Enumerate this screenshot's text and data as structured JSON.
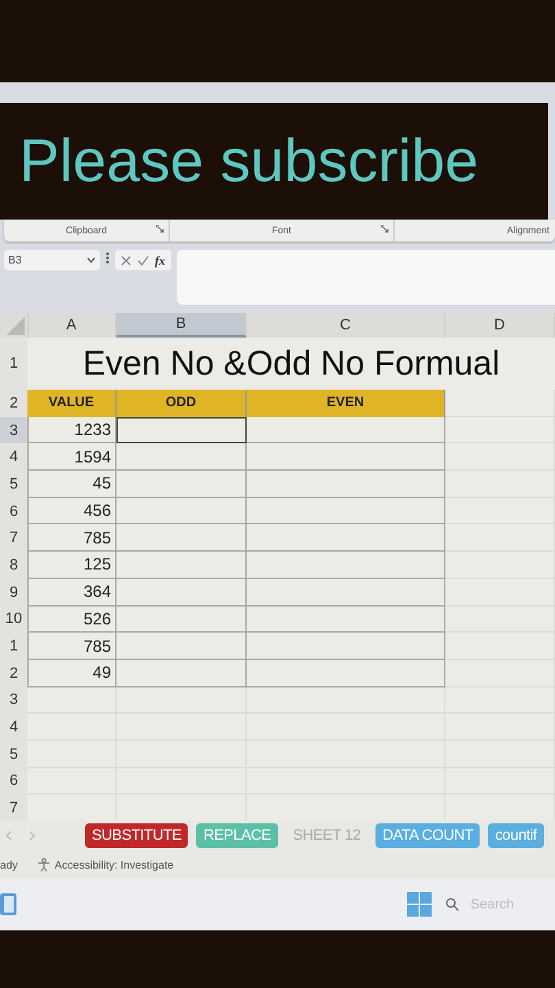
{
  "overlay": {
    "text": "Please subscribe"
  },
  "ribbon": {
    "groups": [
      {
        "label": "Clipboard",
        "launcher": true
      },
      {
        "label": "Font",
        "launcher": true
      },
      {
        "label": "Alignment",
        "launcher": false
      }
    ]
  },
  "formula_bar": {
    "name_box": "B3",
    "function_label": "fx"
  },
  "columns": [
    {
      "label": "A",
      "selected": false
    },
    {
      "label": "B",
      "selected": true
    },
    {
      "label": "C",
      "selected": false
    },
    {
      "label": "D",
      "selected": false
    }
  ],
  "title_row": {
    "header": "1",
    "text": "Even No &Odd No Formual"
  },
  "header_row": {
    "header": "2",
    "labels": [
      "VALUE",
      "ODD",
      "EVEN"
    ]
  },
  "rows": [
    {
      "header": "3",
      "selected": true,
      "cells": [
        {
          "text": "1233",
          "selected": false
        },
        {
          "selected": true
        },
        {
          "selected": false
        }
      ]
    },
    {
      "header": "4",
      "selected": false,
      "cells": [
        {
          "text": "1594",
          "selected": false
        },
        {
          "selected": false
        },
        {
          "selected": false
        }
      ]
    },
    {
      "header": "5",
      "selected": false,
      "cells": [
        {
          "text": "45",
          "selected": false
        },
        {
          "selected": false
        },
        {
          "selected": false
        }
      ]
    },
    {
      "header": "6",
      "selected": false,
      "cells": [
        {
          "text": "456",
          "selected": false
        },
        {
          "selected": false
        },
        {
          "selected": false
        }
      ]
    },
    {
      "header": "7",
      "selected": false,
      "cells": [
        {
          "text": "785",
          "selected": false
        },
        {
          "selected": false
        },
        {
          "selected": false
        }
      ]
    },
    {
      "header": "8",
      "selected": false,
      "cells": [
        {
          "text": "125",
          "selected": false
        },
        {
          "selected": false
        },
        {
          "selected": false
        }
      ]
    },
    {
      "header": "9",
      "selected": false,
      "cells": [
        {
          "text": "364",
          "selected": false
        },
        {
          "selected": false
        },
        {
          "selected": false
        }
      ]
    },
    {
      "header": "10",
      "selected": false,
      "cells": [
        {
          "text": "526",
          "selected": false
        },
        {
          "selected": false
        },
        {
          "selected": false
        }
      ]
    },
    {
      "header": "1",
      "selected": false,
      "cells": [
        {
          "text": "785",
          "selected": false
        },
        {
          "selected": false
        },
        {
          "selected": false
        }
      ]
    },
    {
      "header": "2",
      "selected": false,
      "cells": [
        {
          "text": "49",
          "selected": false
        },
        {
          "selected": false
        },
        {
          "selected": false
        }
      ]
    }
  ],
  "empty_rows": [
    "3",
    "4",
    "5",
    "6",
    "7"
  ],
  "sheet_tabs": [
    {
      "label": "SUBSTITUTE",
      "color": "#c0282a"
    },
    {
      "label": "REPLACE",
      "color": "#5cbfa8"
    },
    {
      "label": "SHEET 12"
    },
    {
      "label": "DATA COUNT",
      "color": "#5aaee0"
    },
    {
      "label": "countif",
      "color": "#5aaee0"
    }
  ],
  "status_bar": {
    "mode": "ady",
    "accessibility": "Accessibility: Investigate"
  },
  "taskbar": {
    "search_placeholder": "Search"
  }
}
